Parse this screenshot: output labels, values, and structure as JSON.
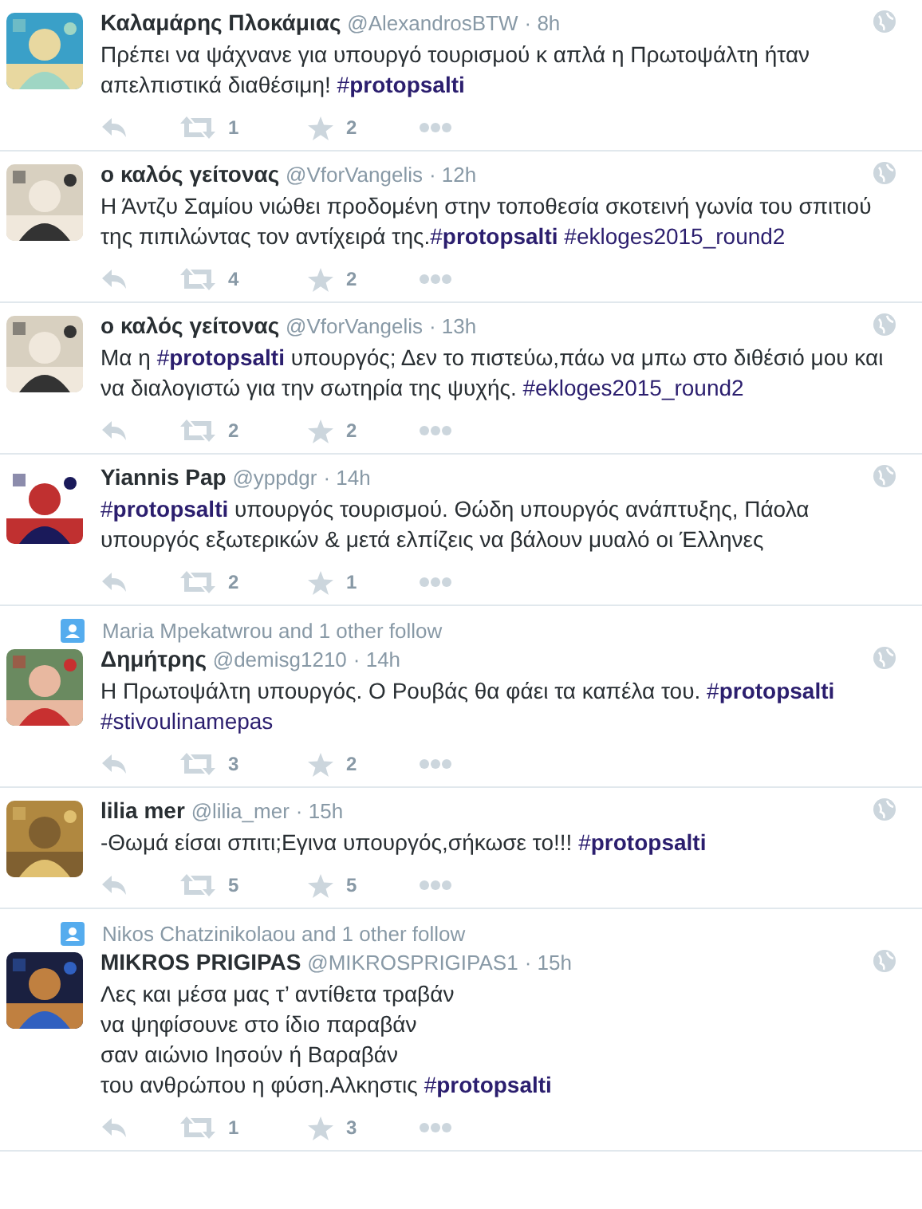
{
  "tweets": [
    {
      "name": "Καλαμάρης Πλοκάμιας",
      "handle": "@AlexandrosBTW",
      "time": "· 8h",
      "parts": [
        {
          "kind": "plain",
          "text": "Πρέπει να ψάχνανε για υπουργό τουρισμού κ απλά η Πρωτοψάλτη ήταν απελπιστικά διαθέσιμη! "
        },
        {
          "kind": "hashtag",
          "text": "#**protopsalti**"
        }
      ],
      "retweets": "1",
      "favorites": "2"
    },
    {
      "name": "ο καλός γείτονας",
      "handle": "@VforVangelis",
      "time": "· 12h",
      "parts": [
        {
          "kind": "plain",
          "text": "Η Άντζυ Σαμίου νιώθει προδομένη στην τοποθεσία σκοτεινή γωνία του σπιτιού της πιπιλώντας τον αντίχειρά της."
        },
        {
          "kind": "hashtag",
          "text": "#**protopsalti**"
        },
        {
          "kind": "hashtag",
          "text": "#ekloges2015_round2"
        }
      ],
      "retweets": "4",
      "favorites": "2"
    },
    {
      "name": "ο καλός γείτονας",
      "handle": "@VforVangelis",
      "time": "· 13h",
      "parts": [
        {
          "kind": "plain",
          "text": "Μα η "
        },
        {
          "kind": "hashtag",
          "text": "#**protopsalti**"
        },
        {
          "kind": "plain",
          "text": " υπουργός; Δεν το πιστεύω,πάω να μπω στο διθέσιό μου και να διαλογιστώ για την σωτηρία της ψυχής. "
        },
        {
          "kind": "hashtag",
          "text": "#ekloges2015_round2"
        }
      ],
      "retweets": "2",
      "favorites": "2"
    },
    {
      "name": "Yiannis Pap",
      "handle": "@yppdgr",
      "time": "· 14h",
      "parts": [
        {
          "kind": "hashtag",
          "text": "#**protopsalti**"
        },
        {
          "kind": "plain",
          "text": " υπουργός τουρισμού. Θώδη υπουργός ανάπτυξης, Πάολα υπουργός εξωτερικών & μετά ελπίζεις να βάλουν μυαλό οι Έλληνες"
        }
      ],
      "retweets": "2",
      "favorites": "1"
    },
    {
      "context": "Maria Mpekatwrou and 1 other follow",
      "name": "Δημήτρης",
      "handle": "@demisg1210",
      "time": "· 14h",
      "parts": [
        {
          "kind": "plain",
          "text": "Η Πρωτοψάλτη υπουργός. Ο Ρουβάς θα φάει τα καπέλα του. "
        },
        {
          "kind": "hashtag",
          "text": "#**protopsalti**"
        },
        {
          "kind": "hashtag",
          "text": "#stivoulinamepas"
        }
      ],
      "retweets": "3",
      "favorites": "2"
    },
    {
      "name": "lilia mer",
      "handle": "@lilia_mer",
      "time": "· 15h",
      "parts": [
        {
          "kind": "plain",
          "text": "-Θωμά είσαι σπιτι;Εγινα υπουργός,σήκωσε το!!! "
        },
        {
          "kind": "hashtag",
          "text": "#**protopsalti**"
        }
      ],
      "retweets": "5",
      "favorites": "5"
    },
    {
      "context": "Nikos Chatzinikolaou and 1 other follow",
      "name": "MIKROS PRIGIPAS",
      "handle": "@MIKROSPRIGIPAS1",
      "time": "· 15h",
      "parts": [
        {
          "kind": "plain",
          "text": "Λες και μέσα μας τ’ αντίθετα τραβάν\nνα ψηφίσουνε στο ίδιο παραβάν\nσαν αιώνιο Ιησούν ή Βαραβάν\nτου ανθρώπου η φύση.Αλκηστις "
        },
        {
          "kind": "hashtag",
          "text": "#**protopsalti**"
        }
      ],
      "retweets": "1",
      "favorites": "3"
    }
  ]
}
